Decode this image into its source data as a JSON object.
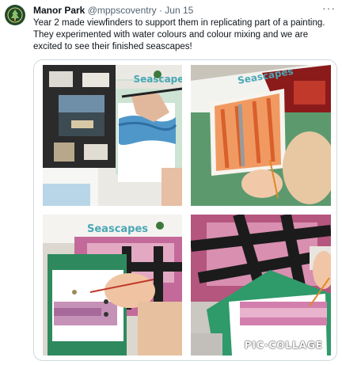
{
  "tweet": {
    "author_name": "Manor Park",
    "handle": "@mppscoventry",
    "separator": "·",
    "date": "Jun 15",
    "more_label": "···",
    "text": "Year 2 made viewfinders to support them in replicating part of a painting.\nThey experimented with water colours and colour mixing and we are\nexcited to see their finished seascapes!"
  },
  "collage": {
    "watermark": "PIC·COLLAGE",
    "photos": [
      {
        "id": "photo-1",
        "poster_title": "Seascapes"
      },
      {
        "id": "photo-2",
        "poster_title": "Seascapes"
      },
      {
        "id": "photo-3",
        "poster_title": "Seascapes"
      },
      {
        "id": "photo-4",
        "poster_title": ""
      }
    ]
  },
  "colors": {
    "avatar_bg": "#1f4a2c",
    "secondary_text": "#536471",
    "border": "#cfd9de"
  }
}
